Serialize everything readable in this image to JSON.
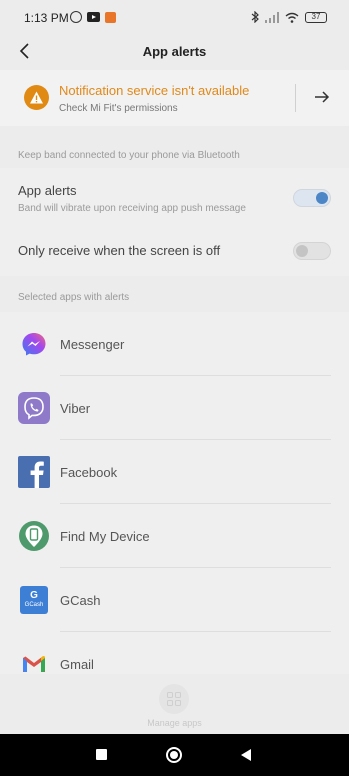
{
  "status_bar": {
    "time": "1:13 PM",
    "battery": "37",
    "icons_left": [
      "alarm-icon",
      "youtube-icon",
      "app-notification-icon"
    ],
    "icons_right": [
      "bluetooth-icon",
      "signal-icon",
      "wifi-icon",
      "battery-icon"
    ]
  },
  "header": {
    "title": "App alerts"
  },
  "notice": {
    "title": "Notification service isn't available",
    "subtitle": "Check Mi Fit's permissions",
    "accent_color": "#e0891a"
  },
  "bluetooth_section": {
    "label": "Keep band connected to your phone via Bluetooth"
  },
  "settings": {
    "app_alerts": {
      "title": "App alerts",
      "subtitle": "Band will vibrate upon receiving app push message",
      "enabled": true
    },
    "screen_off": {
      "title": "Only receive when the screen is off",
      "enabled": false
    }
  },
  "apps_section": {
    "label": "Selected apps with alerts"
  },
  "apps": [
    {
      "name": "Messenger",
      "icon": "messenger-icon"
    },
    {
      "name": "Viber",
      "icon": "viber-icon"
    },
    {
      "name": "Facebook",
      "icon": "facebook-icon"
    },
    {
      "name": "Find My Device",
      "icon": "find-my-device-icon"
    },
    {
      "name": "GCash",
      "icon": "gcash-icon",
      "icon_text": "G",
      "icon_subtext": "GCash"
    },
    {
      "name": "Gmail",
      "icon": "gmail-icon"
    }
  ],
  "bottom": {
    "manage_label": "Manage apps"
  }
}
